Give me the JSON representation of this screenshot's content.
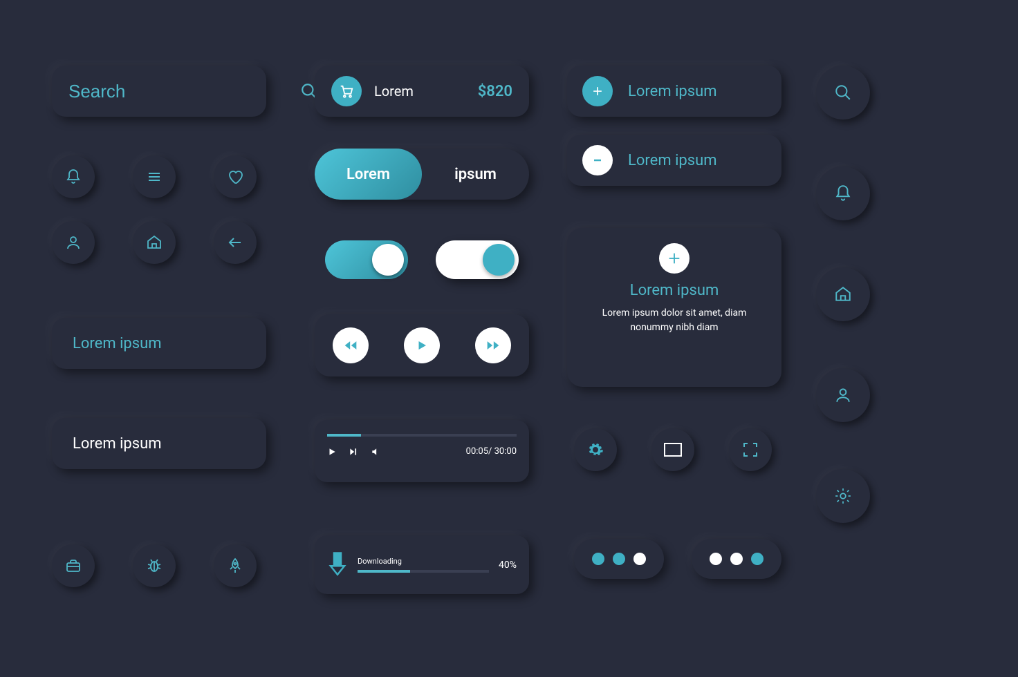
{
  "colors": {
    "accent": "#4fb8c9",
    "bg": "#282c3c"
  },
  "search": {
    "placeholder": "Search"
  },
  "cart": {
    "label": "Lorem",
    "price": "$820"
  },
  "segment": {
    "active": "Lorem",
    "inactive": "ipsum"
  },
  "pills": {
    "one": "Lorem ipsum",
    "two": "Lorem ipsum"
  },
  "list": {
    "add": "Lorem ipsum",
    "remove": "Lorem ipsum"
  },
  "card": {
    "title": "Lorem ipsum",
    "body": "Lorem ipsum dolor sit amet, diam nonummy nibh diam"
  },
  "player": {
    "elapsed": "00:05",
    "sep": "/",
    "total": "30:00"
  },
  "download": {
    "label": "Downloading",
    "percent": "40%"
  },
  "icons": {
    "bell": "bell-icon",
    "menu": "menu-icon",
    "heart": "heart-icon",
    "user": "user-icon",
    "home": "home-icon",
    "back": "back-arrow-icon",
    "briefcase": "briefcase-icon",
    "bug": "bug-icon",
    "rocket": "rocket-icon",
    "settings": "gear-icon",
    "window": "window-icon",
    "fullscreen": "fullscreen-icon",
    "search": "search-icon"
  }
}
